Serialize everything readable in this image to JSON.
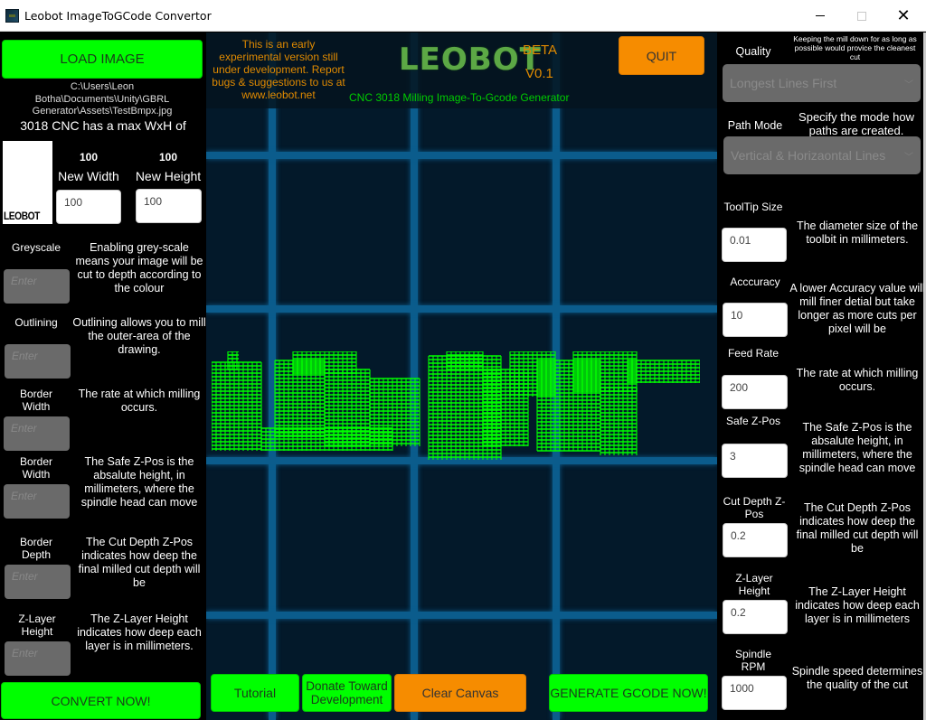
{
  "window": {
    "title": "Leobot ImageToGCode Convertor",
    "controls": {
      "minimize": "—",
      "maximize": "☐",
      "close": "✕"
    }
  },
  "left": {
    "load_image_label": "LOAD IMAGE",
    "file_path": "C:\\Users\\Leon Botha\\Documents\\Unity\\GBRL Generator\\Assets\\TestBmpx.jpg",
    "max_wxh_text": "3018 CNC has a max WxH of",
    "preview_text": "LEOBOT",
    "width_value": "100",
    "height_value": "100",
    "new_width_label": "New Width",
    "new_height_label": "New Height",
    "new_width_input": "100",
    "new_height_input": "100",
    "fields": [
      {
        "label": "Greyscale",
        "placeholder": "Enter",
        "description": "Enabling grey-scale means your image will be cut to depth according to the colour"
      },
      {
        "label": "Outlining",
        "placeholder": "Enter",
        "description": "Outlining allows you to mill the outer-area of the drawing."
      },
      {
        "label": "Border Width",
        "placeholder": "Enter",
        "description": "The rate at which milling occurs."
      },
      {
        "label": "Border Width",
        "placeholder": "Enter",
        "description": "The Safe Z-Pos is the absalute height, in millimeters, where the spindle head can move"
      },
      {
        "label": "Border Depth",
        "placeholder": "Enter",
        "description": "The Cut Depth Z-Pos indicates how deep the final milled cut depth will be"
      },
      {
        "label": "Z-Layer Height",
        "placeholder": "Enter",
        "description": "The Z-Layer Height indicates how deep each layer is in millimeters."
      }
    ],
    "convert_label": "CONVERT NOW!"
  },
  "center": {
    "notice": "This is an early experimental version still under development. Report bugs & suggestions to us at www.leobot.net",
    "logo": "LEOBOT",
    "beta": "BETA",
    "version": "V0.1",
    "subtitle": "CNC 3018 Milling Image-To-Gcode Generator",
    "quit_label": "QUIT",
    "buttons": {
      "tutorial": "Tutorial",
      "donate": "Donate Toward Development",
      "clear_canvas": "Clear Canvas",
      "generate": "GENERATE GCODE NOW!"
    },
    "colors": {
      "toolpath": "#00ff00",
      "grid": "#0b5c8c",
      "background": "#03192a"
    }
  },
  "right": {
    "quality_label": "Quality",
    "quality_desc": "Keeping the mill down for as long as possible would provice the cleanest cut",
    "quality_selected": "Longest Lines First",
    "path_mode_label": "Path Mode",
    "path_mode_desc": "Specify the mode how paths are created.",
    "path_mode_selected": "Vertical & Horizaontal Lines",
    "fields": [
      {
        "label": "ToolTip Size",
        "value": "0.01",
        "description": "The diameter size of the toolbit in millimeters."
      },
      {
        "label": "Acccuracy",
        "value": "10",
        "description": "A lower Accuracy value will mill finer detial but take longer as more cuts per pixel will be"
      },
      {
        "label": "Feed Rate",
        "value": "200",
        "description": "The rate at which milling occurs."
      },
      {
        "label": "Safe Z-Pos",
        "value": "3",
        "description": "The Safe Z-Pos is the absalute height, in millimeters, where the spindle head can move"
      },
      {
        "label": "Cut Depth Z-Pos",
        "value": "0.2",
        "description": "The Cut Depth Z-Pos indicates how deep the final milled cut depth will be"
      },
      {
        "label": "Z-Layer Height",
        "value": "0.2",
        "description": "The Z-Layer Height indicates how deep each layer is in millimeters"
      },
      {
        "label": "Spindle RPM",
        "value": "1000",
        "description": "Spindle speed determines the quality of the cut"
      }
    ]
  },
  "colors": {
    "green_button": "#00ff00",
    "orange_button": "#f68c00",
    "notice_text": "#e08a00",
    "subtitle_text": "#00cc00"
  }
}
